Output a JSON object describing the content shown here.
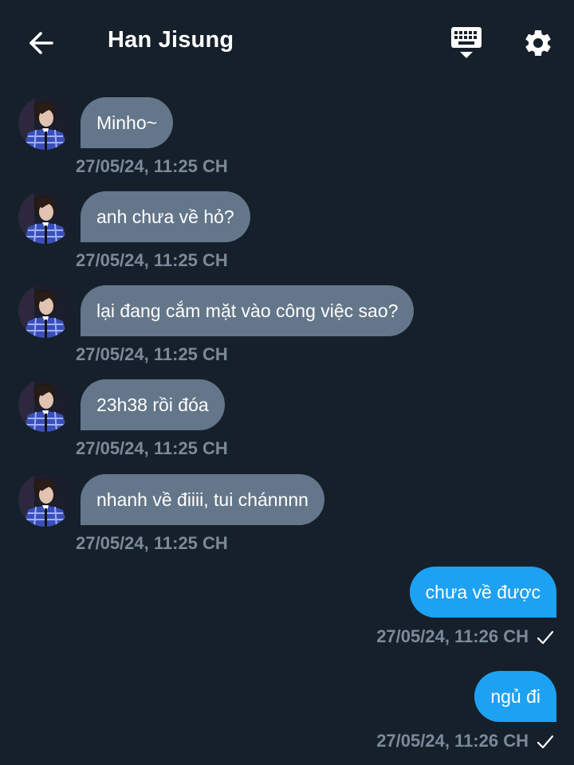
{
  "header": {
    "title": "Han Jisung"
  },
  "messages": {
    "incoming": [
      {
        "text": "Minho~",
        "time": "27/05/24, 11:25 CH"
      },
      {
        "text": "anh chưa về hỏ?",
        "time": "27/05/24, 11:25 CH"
      },
      {
        "text": "lại đang cắm mặt vào công việc sao?",
        "time": "27/05/24, 11:25 CH"
      },
      {
        "text": "23h38 rồi đóa",
        "time": "27/05/24, 11:25 CH"
      },
      {
        "text": "nhanh về điiii, tui chánnnn",
        "time": "27/05/24, 11:25 CH"
      }
    ],
    "outgoing": [
      {
        "text": "chưa về được",
        "time": "27/05/24, 11:26 CH"
      },
      {
        "text": "ngủ đi",
        "time": "27/05/24, 11:26 CH"
      }
    ]
  },
  "icons": [
    "back-arrow-icon",
    "keyboard-icon",
    "gear-icon",
    "avatar",
    "checkmark-icon"
  ],
  "colors": {
    "background": "#15202b",
    "incoming_bubble": "#64768a",
    "outgoing_bubble": "#1da1f2",
    "timestamp": "#7b8a99"
  }
}
